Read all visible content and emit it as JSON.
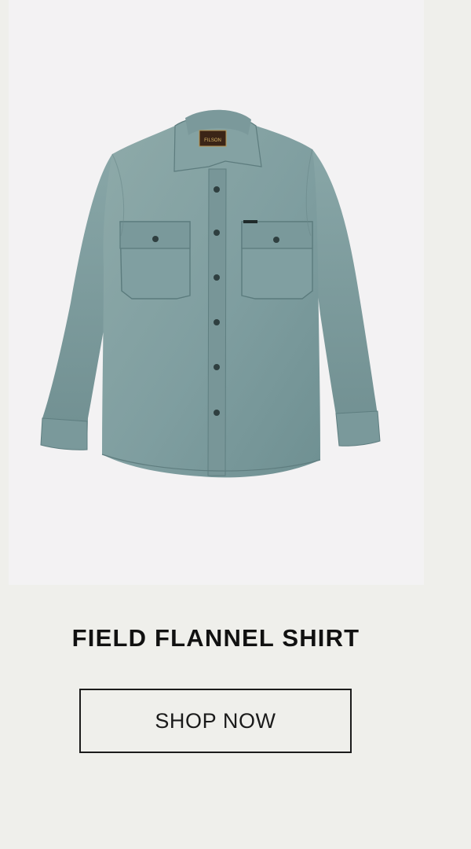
{
  "product": {
    "brand_label": "FILSON",
    "name": "FIELD FLANNEL SHIRT",
    "cta_label": "SHOP NOW",
    "image_description": "Field Flannel Shirt",
    "colors": {
      "page_background": "#efefeb",
      "image_background": "#f3f2f3",
      "shirt": "#7f9ea0",
      "text": "#111111"
    }
  }
}
